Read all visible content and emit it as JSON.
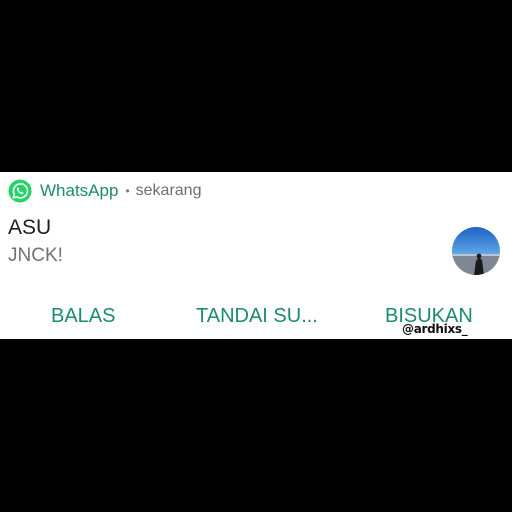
{
  "colors": {
    "accent": "#1d8a72",
    "whatsapp_icon": "#25d366",
    "background": "#000000",
    "card": "#ffffff"
  },
  "notification": {
    "app_name": "WhatsApp",
    "separator": "•",
    "time": "sekarang",
    "app_icon": "whatsapp-icon",
    "title": "ASU",
    "message": "JNCK!",
    "avatar": "contact-avatar"
  },
  "actions": {
    "reply_label": "BALAS",
    "mark_read_label": "TANDAI SU...",
    "mute_label": "BISUKAN"
  },
  "watermark": "@ardhixs_"
}
